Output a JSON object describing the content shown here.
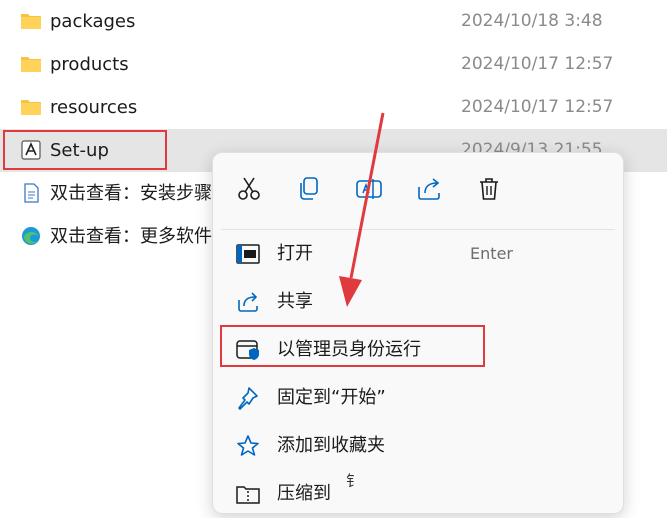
{
  "files": [
    {
      "name": "packages",
      "date": "2024/10/18 3:48",
      "icon": "folder-icon"
    },
    {
      "name": "products",
      "date": "2024/10/17 12:57",
      "icon": "folder-icon"
    },
    {
      "name": "resources",
      "date": "2024/10/17 12:57",
      "icon": "folder-icon"
    },
    {
      "name": "Set-up",
      "date": "2024/9/13 21:55",
      "icon": "adobe-app-icon"
    },
    {
      "name": "双击查看：安装步骤",
      "icon": "document-icon"
    },
    {
      "name": "双击查看：更多软件",
      "icon": "edge-icon"
    }
  ],
  "toolbar": [
    "cut-icon",
    "copy-icon",
    "rename-icon",
    "share-icon",
    "delete-icon"
  ],
  "menu_items": [
    {
      "label": "打开",
      "accel": "Enter",
      "icon": "open-window-icon"
    },
    {
      "label": "共享",
      "icon": "share-icon"
    },
    {
      "label": "以管理员身份运行",
      "icon": "admin-shield-icon"
    },
    {
      "label": "固定到“开始”",
      "icon": "pin-icon"
    },
    {
      "label": "添加到收藏夹",
      "icon": "star-icon"
    },
    {
      "label": "压缩到",
      "icon": "compress-folder-icon"
    }
  ],
  "fragment_text": "钅",
  "colors": {
    "highlight": "#e0393e",
    "accent": "#0067c0",
    "folder": "#f8c243",
    "selected_row": "#e5e5e5"
  }
}
